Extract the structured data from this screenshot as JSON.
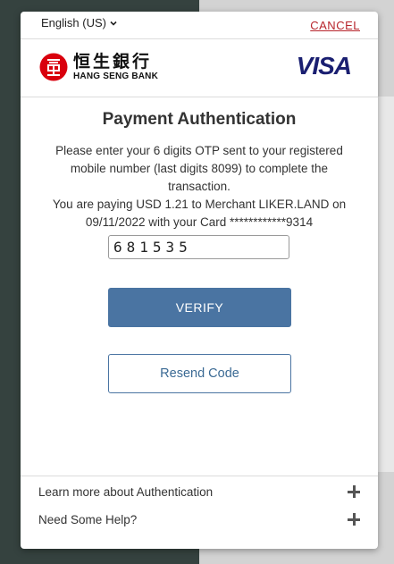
{
  "topbar": {
    "language": "English (US)",
    "cancel": "CANCEL"
  },
  "brand": {
    "bank_cn": "恒生銀行",
    "bank_en": "HANG SENG BANK",
    "card_network": "VISA"
  },
  "content": {
    "title": "Payment Authentication",
    "instruction": "Please enter your 6 digits OTP sent to your registered mobile number (last digits 8099) to complete the transaction.",
    "payment_info": "You are paying USD 1.21 to Merchant LIKER.LAND on 09/11/2022 with your Card ************9314",
    "otp_value": "681535",
    "verify_label": "VERIFY",
    "resend_label": "Resend Code"
  },
  "footer": {
    "items": [
      {
        "label": "Learn more about Authentication"
      },
      {
        "label": "Need Some Help?"
      }
    ]
  },
  "colors": {
    "primary": "#4a74a2",
    "cancel": "#b7252c",
    "visa": "#1a1f71",
    "logo_red": "#d9000d"
  }
}
